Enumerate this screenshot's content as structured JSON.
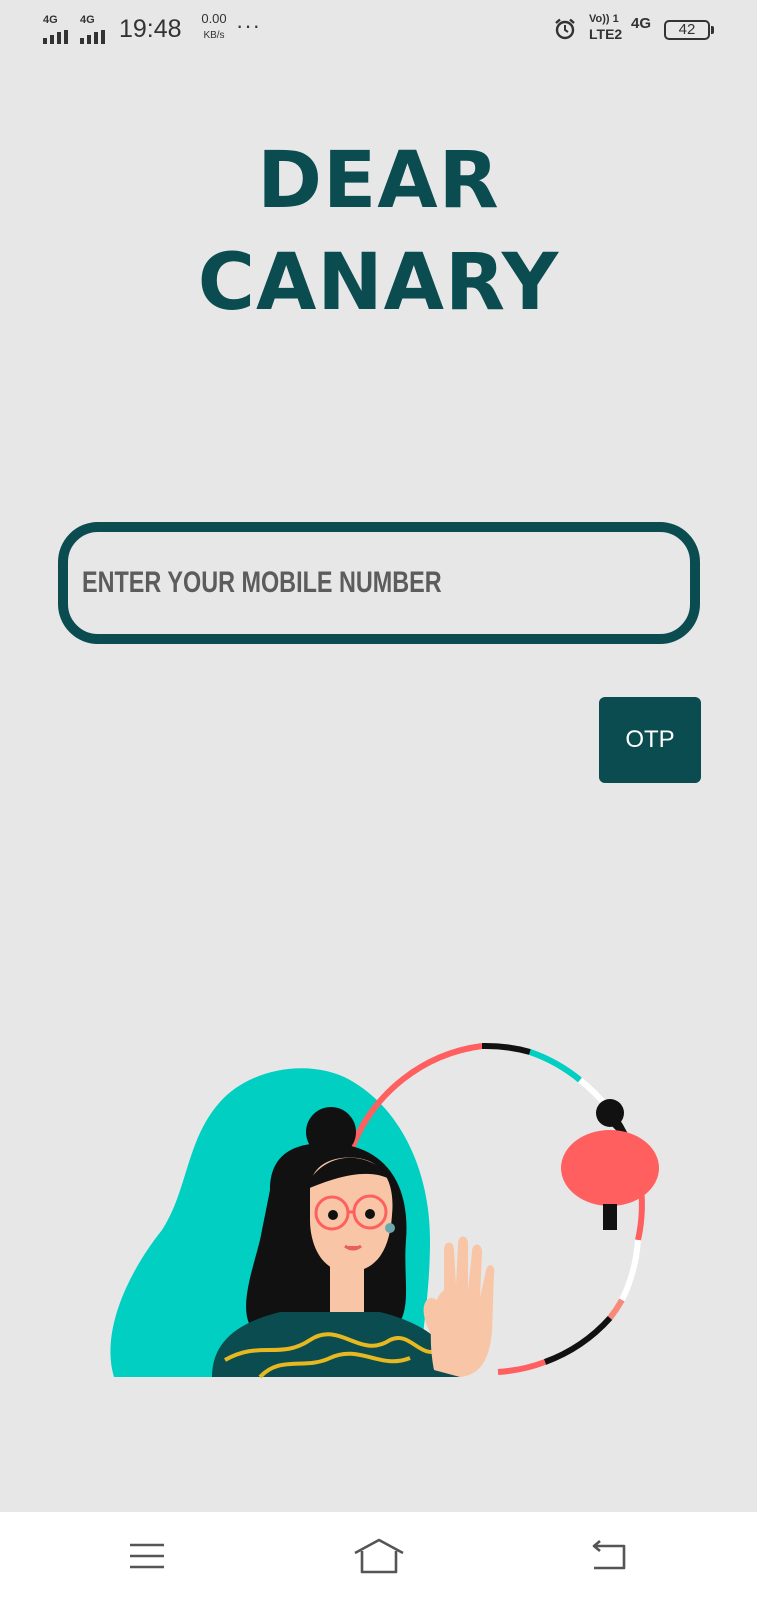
{
  "status_bar": {
    "sim1_network": "4G",
    "sim2_network": "4G",
    "time": "19:48",
    "net_speed_value": "0.00",
    "net_speed_unit": "KB/s",
    "more_indicator": "···",
    "volte_label": "Vo)) 1",
    "lte_label": "LTE2",
    "network_4g": "4G",
    "battery_level": "42",
    "icons": [
      "signal-icon",
      "signal-icon",
      "alarm-icon",
      "battery-icon"
    ]
  },
  "app": {
    "title_line1": "DEAR",
    "title_line2": "CANARY",
    "accent_color": "#0a4c4f"
  },
  "login": {
    "mobile_placeholder": "ENTER YOUR MOBILE NUMBER",
    "mobile_value": "",
    "otp_button_label": "OTP"
  },
  "nav_bar": {
    "icons": [
      "menu-icon",
      "home-icon",
      "back-icon"
    ]
  }
}
